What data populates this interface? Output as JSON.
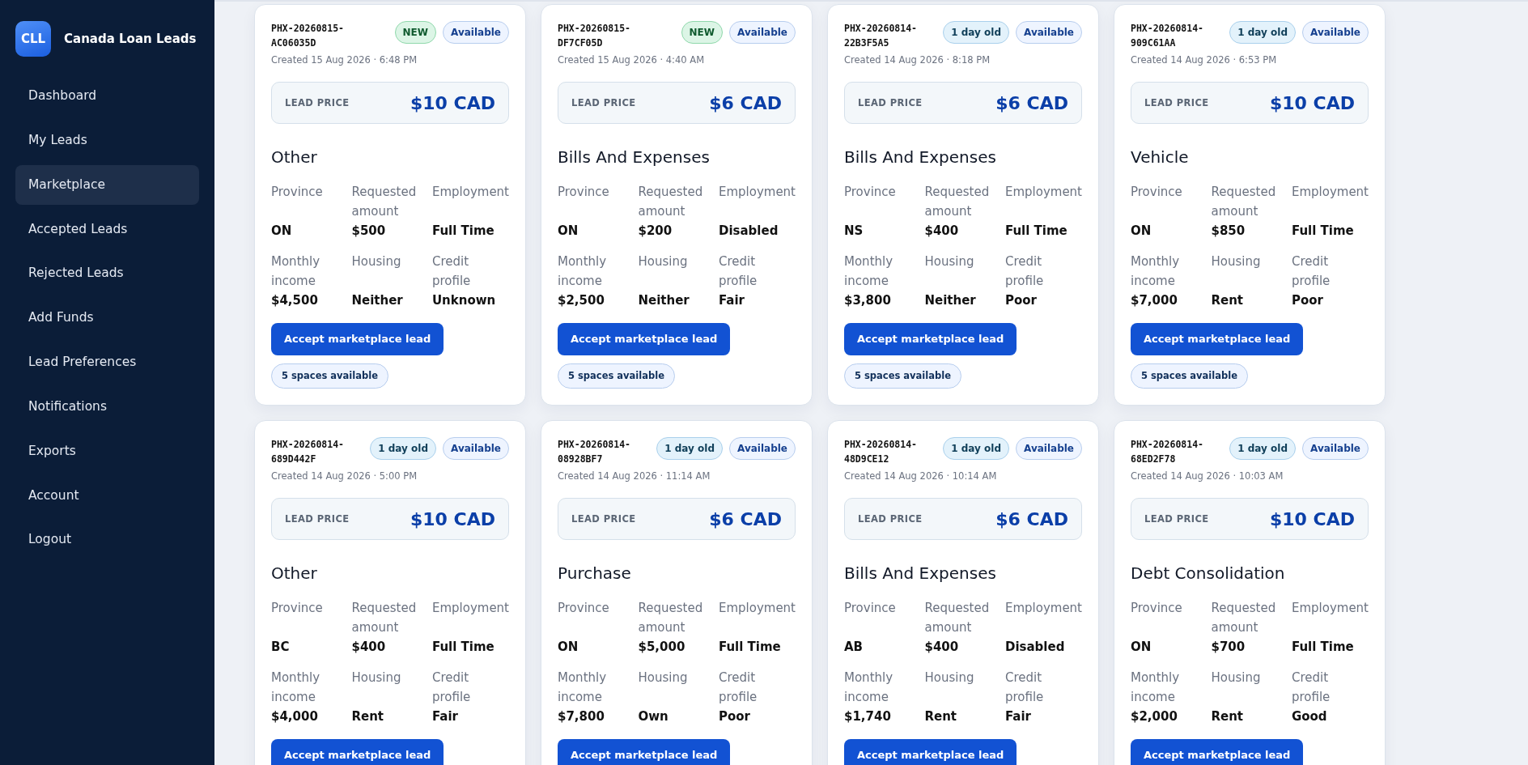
{
  "sidebar": {
    "logo": "CLL",
    "brand": "Canada Loan Leads",
    "items": [
      {
        "label": "Dashboard",
        "selected": false
      },
      {
        "label": "My Leads",
        "selected": false
      },
      {
        "label": "Marketplace",
        "selected": true
      },
      {
        "label": "Accepted Leads",
        "selected": false
      },
      {
        "label": "Rejected Leads",
        "selected": false
      },
      {
        "label": "Add Funds",
        "selected": false
      },
      {
        "label": "Lead Preferences",
        "selected": false
      },
      {
        "label": "Notifications",
        "selected": false
      },
      {
        "label": "Exports",
        "selected": false
      },
      {
        "label": "Account",
        "selected": false
      },
      {
        "label": "Logout",
        "selected": false
      }
    ]
  },
  "leads": [
    {
      "id": "PHX-20260815-AC06035D",
      "badges": [
        {
          "kind": "new",
          "text": "NEW"
        },
        {
          "kind": "status",
          "text": "Available"
        }
      ],
      "created": "Created 15 Aug 2026 · 6:48 PM",
      "price_label": "LEAD PRICE",
      "price": "$10 CAD",
      "category": "Other",
      "fields": [
        {
          "label": "Province",
          "value": "ON"
        },
        {
          "label": "Requested amount",
          "value": "$500"
        },
        {
          "label": "Employment",
          "value": "Full Time"
        },
        {
          "label": "Monthly income",
          "value": "$4,500"
        },
        {
          "label": "Housing",
          "value": "Neither"
        },
        {
          "label": "Credit profile",
          "value": "Unknown"
        }
      ],
      "button": "Accept marketplace lead",
      "spaces": "5 spaces available"
    },
    {
      "id": "PHX-20260815-DF7CF05D",
      "badges": [
        {
          "kind": "new",
          "text": "NEW"
        },
        {
          "kind": "status",
          "text": "Available"
        }
      ],
      "created": "Created 15 Aug 2026 · 4:40 AM",
      "price_label": "LEAD PRICE",
      "price": "$6 CAD",
      "category": "Bills And Expenses",
      "fields": [
        {
          "label": "Province",
          "value": "ON"
        },
        {
          "label": "Requested amount",
          "value": "$200"
        },
        {
          "label": "Employment",
          "value": "Disabled"
        },
        {
          "label": "Monthly income",
          "value": "$2,500"
        },
        {
          "label": "Housing",
          "value": "Neither"
        },
        {
          "label": "Credit profile",
          "value": "Fair"
        }
      ],
      "button": "Accept marketplace lead",
      "spaces": "5 spaces available"
    },
    {
      "id": "PHX-20260814-22B3F5A5",
      "badges": [
        {
          "kind": "age",
          "text": "1 day old"
        },
        {
          "kind": "status",
          "text": "Available"
        }
      ],
      "created": "Created 14 Aug 2026 · 8:18 PM",
      "price_label": "LEAD PRICE",
      "price": "$6 CAD",
      "category": "Bills And Expenses",
      "fields": [
        {
          "label": "Province",
          "value": "NS"
        },
        {
          "label": "Requested amount",
          "value": "$400"
        },
        {
          "label": "Employment",
          "value": "Full Time"
        },
        {
          "label": "Monthly income",
          "value": "$3,800"
        },
        {
          "label": "Housing",
          "value": "Neither"
        },
        {
          "label": "Credit profile",
          "value": "Poor"
        }
      ],
      "button": "Accept marketplace lead",
      "spaces": "5 spaces available"
    },
    {
      "id": "PHX-20260814-909C61AA",
      "badges": [
        {
          "kind": "age",
          "text": "1 day old"
        },
        {
          "kind": "status",
          "text": "Available"
        }
      ],
      "created": "Created 14 Aug 2026 · 6:53 PM",
      "price_label": "LEAD PRICE",
      "price": "$10 CAD",
      "category": "Vehicle",
      "fields": [
        {
          "label": "Province",
          "value": "ON"
        },
        {
          "label": "Requested amount",
          "value": "$850"
        },
        {
          "label": "Employment",
          "value": "Full Time"
        },
        {
          "label": "Monthly income",
          "value": "$7,000"
        },
        {
          "label": "Housing",
          "value": "Rent"
        },
        {
          "label": "Credit profile",
          "value": "Poor"
        }
      ],
      "button": "Accept marketplace lead",
      "spaces": "5 spaces available"
    },
    {
      "id": "PHX-20260814-689D442F",
      "badges": [
        {
          "kind": "age",
          "text": "1 day old"
        },
        {
          "kind": "status",
          "text": "Available"
        }
      ],
      "created": "Created 14 Aug 2026 · 5:00 PM",
      "price_label": "LEAD PRICE",
      "price": "$10 CAD",
      "category": "Other",
      "fields": [
        {
          "label": "Province",
          "value": "BC"
        },
        {
          "label": "Requested amount",
          "value": "$400"
        },
        {
          "label": "Employment",
          "value": "Full Time"
        },
        {
          "label": "Monthly income",
          "value": "$4,000"
        },
        {
          "label": "Housing",
          "value": "Rent"
        },
        {
          "label": "Credit profile",
          "value": "Fair"
        }
      ],
      "button": "Accept marketplace lead"
    },
    {
      "id": "PHX-20260814-08928BF7",
      "badges": [
        {
          "kind": "age",
          "text": "1 day old"
        },
        {
          "kind": "status",
          "text": "Available"
        }
      ],
      "created": "Created 14 Aug 2026 · 11:14 AM",
      "price_label": "LEAD PRICE",
      "price": "$6 CAD",
      "category": "Purchase",
      "fields": [
        {
          "label": "Province",
          "value": "ON"
        },
        {
          "label": "Requested amount",
          "value": "$5,000"
        },
        {
          "label": "Employment",
          "value": "Full Time"
        },
        {
          "label": "Monthly income",
          "value": "$7,800"
        },
        {
          "label": "Housing",
          "value": "Own"
        },
        {
          "label": "Credit profile",
          "value": "Poor"
        }
      ],
      "button": "Accept marketplace lead"
    },
    {
      "id": "PHX-20260814-48D9CE12",
      "badges": [
        {
          "kind": "age",
          "text": "1 day old"
        },
        {
          "kind": "status",
          "text": "Available"
        }
      ],
      "created": "Created 14 Aug 2026 · 10:14 AM",
      "price_label": "LEAD PRICE",
      "price": "$6 CAD",
      "category": "Bills And Expenses",
      "fields": [
        {
          "label": "Province",
          "value": "AB"
        },
        {
          "label": "Requested amount",
          "value": "$400"
        },
        {
          "label": "Employment",
          "value": "Disabled"
        },
        {
          "label": "Monthly income",
          "value": "$1,740"
        },
        {
          "label": "Housing",
          "value": "Rent"
        },
        {
          "label": "Credit profile",
          "value": "Fair"
        }
      ],
      "button": "Accept marketplace lead"
    },
    {
      "id": "PHX-20260814-68ED2F78",
      "badges": [
        {
          "kind": "age",
          "text": "1 day old"
        },
        {
          "kind": "status",
          "text": "Available"
        }
      ],
      "created": "Created 14 Aug 2026 · 10:03 AM",
      "price_label": "LEAD PRICE",
      "price": "$10 CAD",
      "category": "Debt Consolidation",
      "fields": [
        {
          "label": "Province",
          "value": "ON"
        },
        {
          "label": "Requested amount",
          "value": "$700"
        },
        {
          "label": "Employment",
          "value": "Full Time"
        },
        {
          "label": "Monthly income",
          "value": "$2,000"
        },
        {
          "label": "Housing",
          "value": "Rent"
        },
        {
          "label": "Credit profile",
          "value": "Good"
        }
      ],
      "button": "Accept marketplace lead"
    }
  ]
}
